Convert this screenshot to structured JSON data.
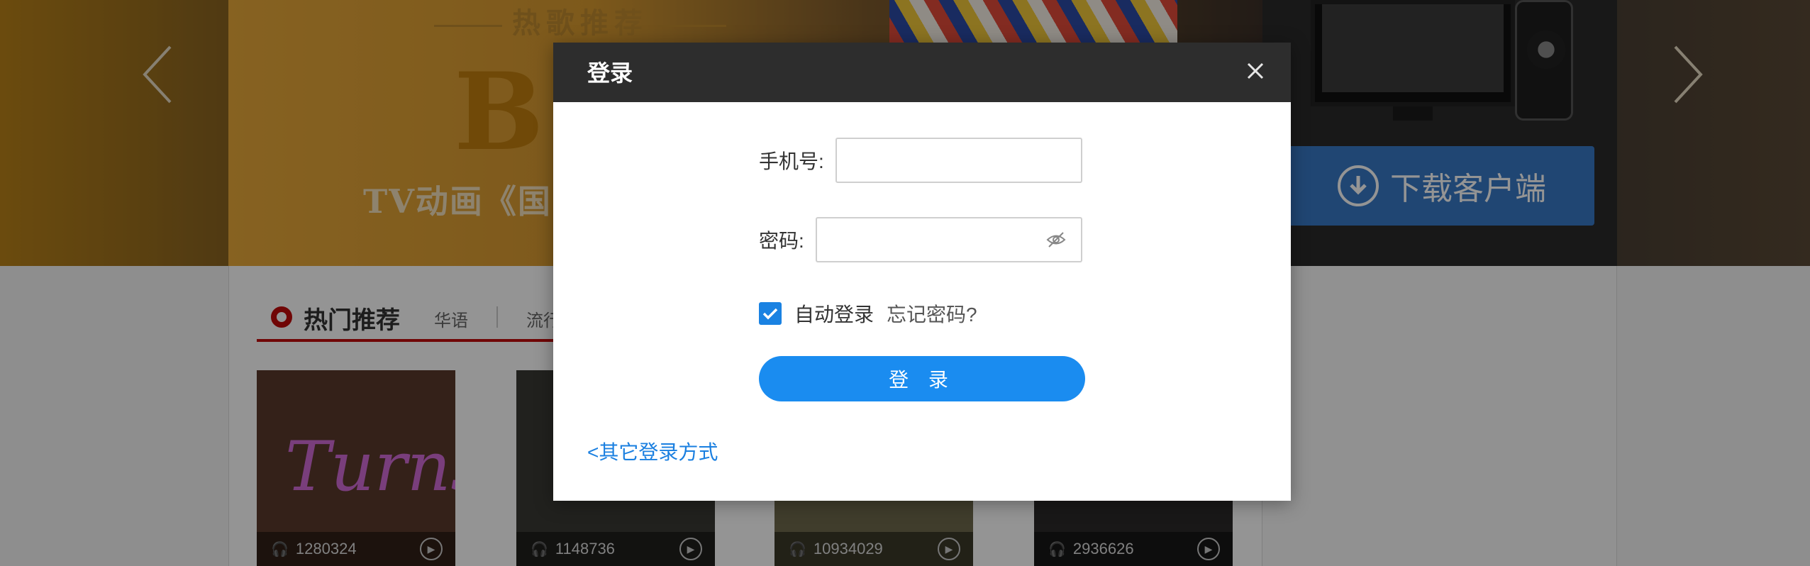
{
  "banner": {
    "subtitle": "热歌推荐",
    "big_text": "BC",
    "tv_text": "TV动画《国",
    "download_label": "下载客户端"
  },
  "section": {
    "title": "热门推荐",
    "tabs": [
      "华语",
      "流行"
    ]
  },
  "cards": [
    {
      "plays": "1280324",
      "cover_text": "Turns"
    },
    {
      "plays": "1148736"
    },
    {
      "plays": "10934029"
    },
    {
      "plays": "2936626"
    }
  ],
  "modal": {
    "title": "登录",
    "phone_label": "手机号:",
    "phone_value": "",
    "password_label": "密码:",
    "password_value": "",
    "auto_login_label": "自动登录",
    "auto_login_checked": true,
    "forgot_label": "忘记密码?",
    "login_button": "登 录",
    "other_login": "<其它登录方式"
  },
  "colors": {
    "accent": "#1a8cf0",
    "checkbox": "#1a82e2",
    "header_bg": "#2d2d2d",
    "section_red": "#c20c0c",
    "link_blue": "#1a7fe0"
  },
  "icons": {
    "close": "close-icon",
    "eye": "eye-hidden-icon",
    "check": "check-icon",
    "prev": "chevron-left-icon",
    "next": "chevron-right-icon",
    "download": "download-icon",
    "headphones": "headphones-icon",
    "play": "play-icon"
  }
}
